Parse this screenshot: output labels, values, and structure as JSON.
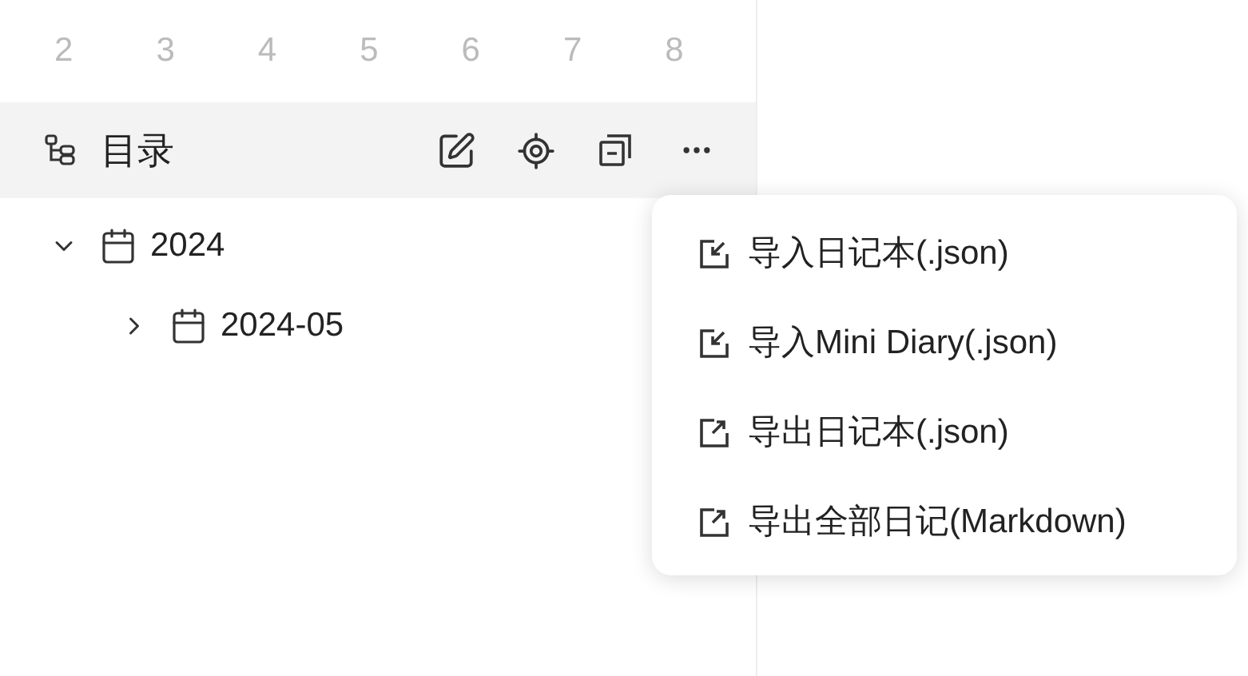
{
  "calendar_days": [
    "2",
    "3",
    "4",
    "5",
    "6",
    "7",
    "8"
  ],
  "toolbar": {
    "title": "目录"
  },
  "tree": [
    {
      "label": "2024",
      "expanded": true,
      "children": [
        {
          "label": "2024-05",
          "expanded": false
        }
      ]
    }
  ],
  "menu": [
    {
      "label": "导入日记本(.json)",
      "kind": "import"
    },
    {
      "label": "导入Mini Diary(.json)",
      "kind": "import"
    },
    {
      "label": "导出日记本(.json)",
      "kind": "export"
    },
    {
      "label": "导出全部日记(Markdown)",
      "kind": "export"
    }
  ]
}
